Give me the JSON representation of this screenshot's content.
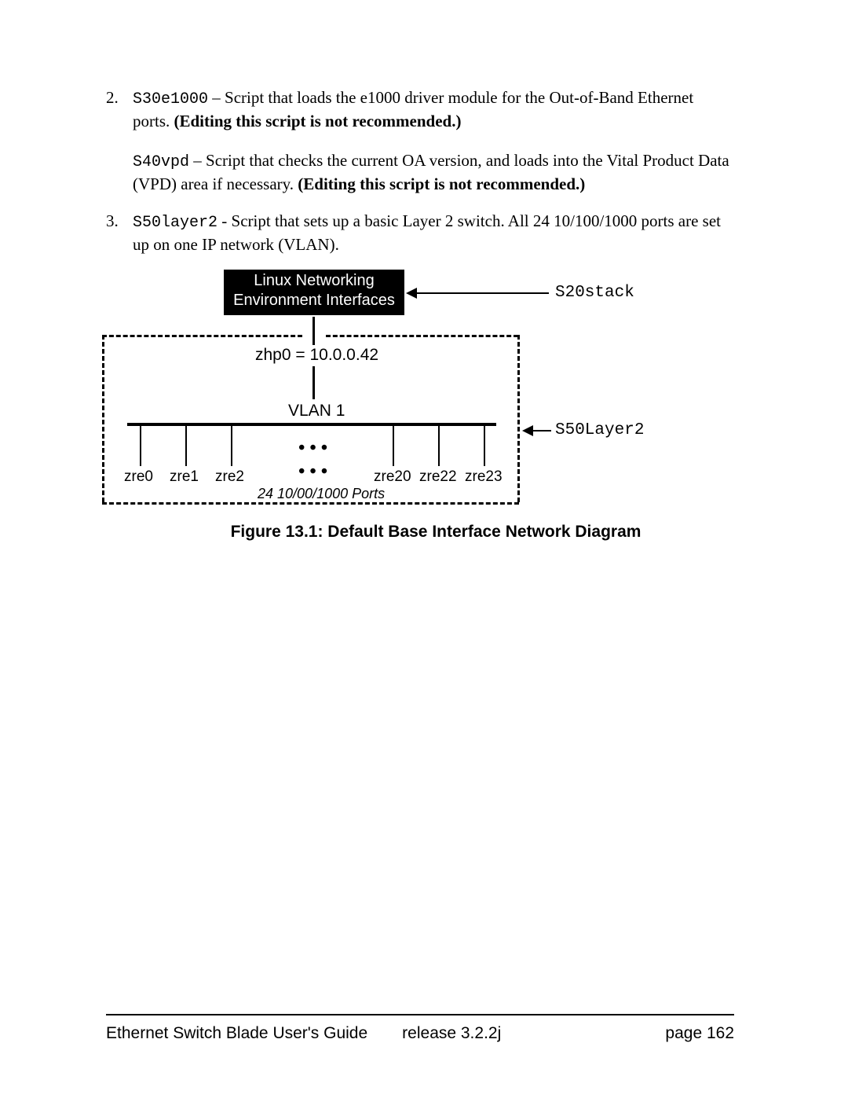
{
  "items": [
    {
      "num": "2.",
      "code": "S30e1000",
      "sep": " – ",
      "text1": "Script that loads the e1000 driver module for the Out-of-Band Ethernet ports. ",
      "bold1": "(Editing this script is not recommended.)",
      "para2_code": "S40vpd",
      "para2_sep": " – ",
      "para2_text": "Script that checks the current OA version, and loads into the Vital Product Data (VPD) area if necessary. ",
      "para2_bold": "(Editing this script is not recommended.)"
    },
    {
      "num": "3.",
      "code": "S50layer2",
      "sep": " - ",
      "text1": "Script that sets up a basic Layer 2 switch. All 24 10/100/1000 ports are set up on one IP network (VLAN)."
    }
  ],
  "diagram": {
    "title_line1": "Linux Networking",
    "title_line2": "Environment Interfaces",
    "label_s20": "S20stack",
    "label_s50": "S50Layer2",
    "zhp": "zhp0 = 10.0.0.42",
    "vlan": "VLAN 1",
    "ports": [
      "zre0",
      "zre1",
      "zre2",
      "zre20",
      "zre22",
      "zre23"
    ],
    "ports_note": "24 10/00/1000 Ports",
    "caption": "Figure 13.1: Default Base Interface Network Diagram"
  },
  "footer": {
    "title": "Ethernet Switch Blade User's Guide",
    "release_label": "release  3.2.2j",
    "page_label": "page 162"
  }
}
